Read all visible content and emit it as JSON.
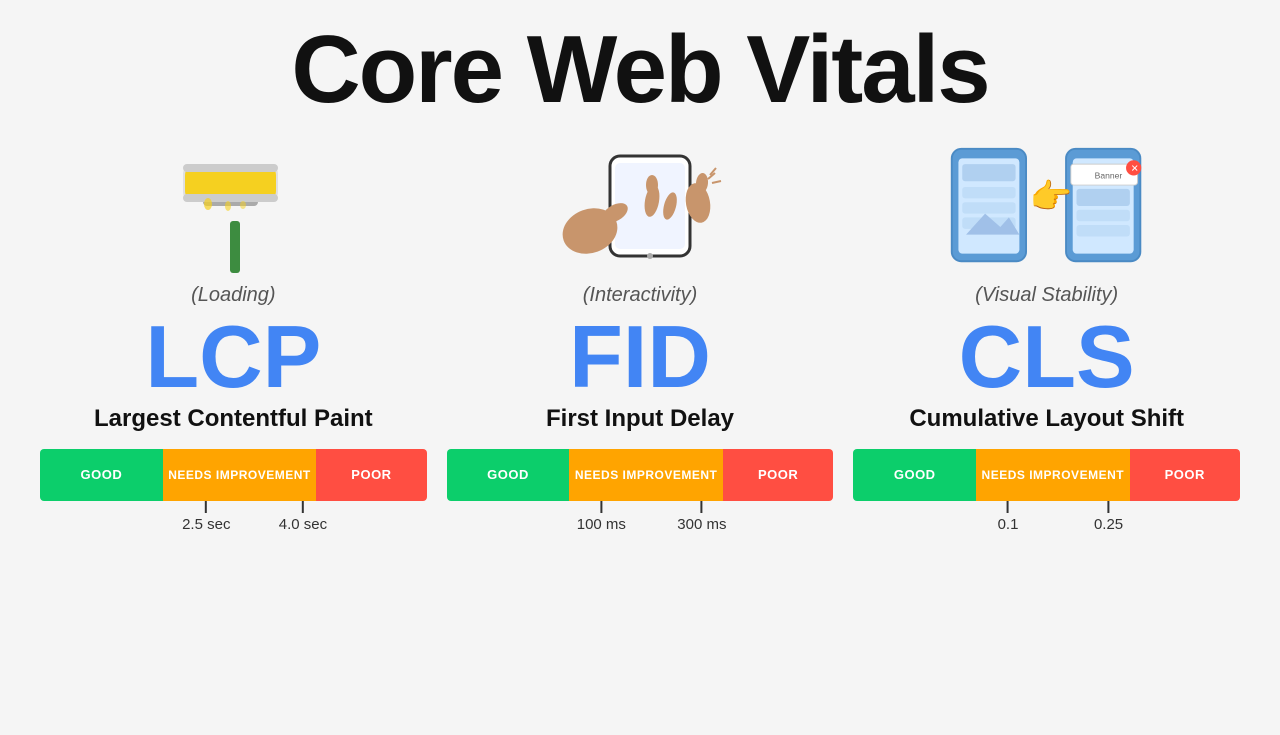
{
  "page": {
    "title": "Core Web Vitals"
  },
  "metrics": [
    {
      "id": "lcp",
      "category": "(Loading)",
      "acronym": "LCP",
      "fullname": "Largest Contentful Paint",
      "bar": {
        "good_label": "GOOD",
        "needs_label": "NEEDS IMPROVEMENT",
        "poor_label": "POOR"
      },
      "tick1": "2.5 sec",
      "tick2": "4.0 sec"
    },
    {
      "id": "fid",
      "category": "(Interactivity)",
      "acronym": "FID",
      "fullname": "First Input Delay",
      "bar": {
        "good_label": "GOOD",
        "needs_label": "NEEDS IMPROVEMENT",
        "poor_label": "POOR"
      },
      "tick1": "100 ms",
      "tick2": "300 ms"
    },
    {
      "id": "cls",
      "category": "(Visual Stability)",
      "acronym": "CLS",
      "fullname": "Cumulative Layout Shift",
      "bar": {
        "good_label": "GOOD",
        "needs_label": "NEEDS IMPROVEMENT",
        "poor_label": "POOR"
      },
      "tick1": "0.1",
      "tick2": "0.25"
    }
  ],
  "colors": {
    "good": "#0cce6b",
    "needs": "#ffa400",
    "poor": "#ff4e42",
    "accent": "#4285f4"
  }
}
